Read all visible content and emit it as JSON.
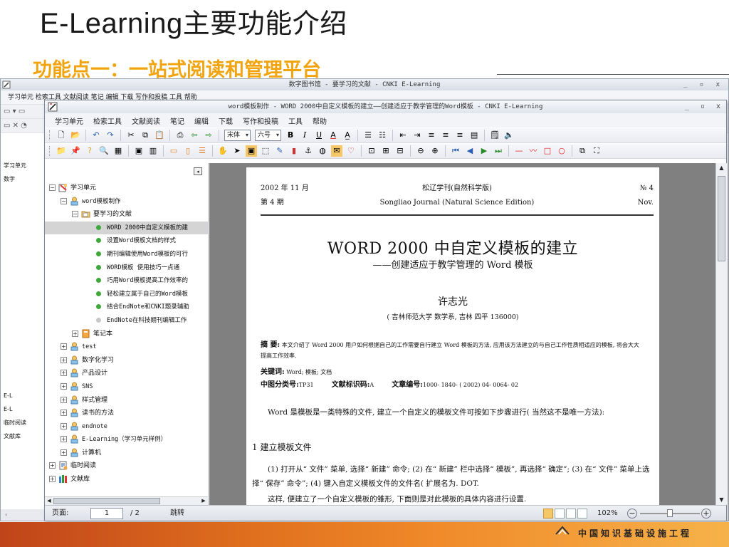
{
  "slide": {
    "title_latin": "E-Learning",
    "title_cn": "主要功能介绍",
    "subtitle": "功能点一：一站式阅读和管理平台",
    "footer": "中国知识基础设施工程"
  },
  "background_window": {
    "title": "数字图书馆 - 要学习的文献 - CNKI E-Learning",
    "controls": "_ ▫ x",
    "menu": "学习单元  检索工具  文献阅读  笔记  编辑  下载  写作和投稿  工具  帮助",
    "tree": [
      "学习单元",
      "数字",
      "",
      "",
      "",
      "",
      "",
      "",
      "",
      "",
      "",
      "",
      "",
      "",
      "",
      "",
      "",
      "E-L",
      "E-L",
      "临时阅读",
      "文献库"
    ]
  },
  "window": {
    "title": "word模板制作 - WORD 2000中自定义模板的建立——创建适应于教学管理的Word模板 - CNKI E-Learning",
    "controls": {
      "minimize": "_",
      "maximize": "▫",
      "close": "x"
    },
    "menu": [
      "学习单元",
      "检索工具",
      "文献阅读",
      "笔记",
      "编辑",
      "下载",
      "写作和投稿",
      "工具",
      "帮助"
    ],
    "font_combo": "宋体",
    "size_combo": "六号"
  },
  "tree": {
    "collapse_glyph": "◂",
    "nodes": [
      {
        "label": "学习单元",
        "level": 0,
        "type": "root",
        "exp": "⊟"
      },
      {
        "label": "word模板制作",
        "level": 1,
        "type": "unit",
        "exp": "⊟"
      },
      {
        "label": "要学习的文献",
        "level": 2,
        "type": "folder",
        "exp": "⊟"
      },
      {
        "label": "WORD 2000中自定义模板的建",
        "level": 3,
        "type": "doc",
        "selected": true
      },
      {
        "label": "设置Word模板文档的样式",
        "level": 3,
        "type": "doc"
      },
      {
        "label": "期刊编辑使用Word模板的可行",
        "level": 3,
        "type": "doc"
      },
      {
        "label": "WORD模板  使用技巧一点通",
        "level": 3,
        "type": "doc"
      },
      {
        "label": "巧用Word模板提高工作效率的",
        "level": 3,
        "type": "doc"
      },
      {
        "label": "轻松建立属于自己的Word模板",
        "level": 3,
        "type": "doc"
      },
      {
        "label": "结合EndNote和CNKI题录辅助",
        "level": 3,
        "type": "doc"
      },
      {
        "label": "EndNote在科技期刊编辑工作",
        "level": 3,
        "type": "doc-gray"
      },
      {
        "label": "笔记本",
        "level": 2,
        "type": "notebook",
        "exp": "⊞"
      },
      {
        "label": "test",
        "level": 1,
        "type": "unit",
        "exp": "⊞"
      },
      {
        "label": "数字化学习",
        "level": 1,
        "type": "unit",
        "exp": "⊞"
      },
      {
        "label": "产品设计",
        "level": 1,
        "type": "unit",
        "exp": "⊞"
      },
      {
        "label": "SNS",
        "level": 1,
        "type": "unit",
        "exp": "⊞"
      },
      {
        "label": "样式管理",
        "level": 1,
        "type": "unit",
        "exp": "⊞"
      },
      {
        "label": "读书的方法",
        "level": 1,
        "type": "unit",
        "exp": "⊞"
      },
      {
        "label": "endnote",
        "level": 1,
        "type": "unit",
        "exp": "⊞"
      },
      {
        "label": "E-Learning（学习单元样例）",
        "level": 1,
        "type": "unit",
        "exp": "⊞"
      },
      {
        "label": "计算机",
        "level": 1,
        "type": "unit",
        "exp": "⊞"
      },
      {
        "label": "临时阅读",
        "level": 0,
        "type": "temp",
        "exp": "⊞"
      },
      {
        "label": "文献库",
        "level": 0,
        "type": "library",
        "exp": "⊞"
      }
    ]
  },
  "document": {
    "head_date": "2002 年 11 月",
    "head_journal_cn": "松辽学刊(自然科学版)",
    "head_no": "№ 4",
    "head_issue": "第 4 期",
    "head_journal_en": "Songliao Journal (Natural Science Edition)",
    "head_month": "Nov.",
    "title": "WORD 2000 中自定义模板的建立",
    "subtitle": "——创建适应于教学管理的 Word 模板",
    "author": "许志光",
    "affiliation": "( 吉林师范大学 数学系, 吉林 四平 136000)",
    "abstract_label": "摘    要:",
    "abstract_text": "本文介绍了 Word 2000 用户如何根据自己的工作需要自行建立 Word 模板的方法, 应用该方法建立的与自己工作性质相适应的模板, 将会大大提高工作效率.",
    "keywords_label": "关键词:",
    "keywords_text": "Word; 模板; 文档",
    "clc_label": "中图分类号:",
    "clc_value": "TP31",
    "doccode_label": "文献标识码:",
    "doccode_value": "A",
    "articleno_label": "文章编号:",
    "articleno_value": "1000- 1840- ( 2002) 04- 0064- 02",
    "body_p1": "Word 是模板是一类特殊的文件, 建立一个自定义的模板文件可按如下步骤进行( 当然这不是唯一方法):",
    "section1": "1   建立模板文件",
    "body_p2": "(1) 打开从“ 文件” 菜单, 选择“ 新建” 命令; (2) 在“ 新建” 栏中选择“ 模板”, 再选择“ 确定”; (3) 在“ 文件” 菜单上选择“ 保存” 命令”; (4) 键入自定义模板文件的文件名( 扩展名为. DOT.",
    "body_p3": "这样, 便建立了一个自定义模板的雏形, 下面则是对此模板的具体内容进行设置."
  },
  "status": {
    "page_label": "页面:",
    "page_current": "1",
    "page_total": "/ 2",
    "jump": "跳转",
    "zoom": "102%",
    "zoom_level": 0.5
  },
  "colors": {
    "subtitle": "#f2a40e",
    "selected_row": "#d4d4d4",
    "doc_dot": "#3ea83a",
    "band": "#e0701e"
  }
}
